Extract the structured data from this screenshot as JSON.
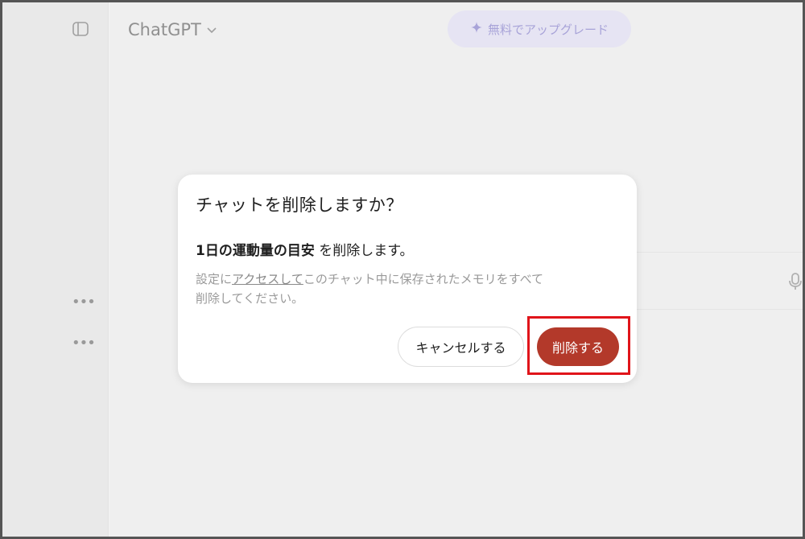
{
  "app": {
    "model_name": "ChatGPT",
    "upgrade_label": "無料でアップグレード"
  },
  "dialog": {
    "title": "チャットを削除しますか？",
    "chat_name": "1日の運動量の目安",
    "delete_suffix": " を削除します。",
    "note_prefix": "設定に",
    "note_link": "アクセスして",
    "note_line1_rest": "このチャット中に保存されたメモリをすべて",
    "note_line2": "削除してください。",
    "cancel_label": "キャンセルする",
    "delete_label": "削除する"
  },
  "sidebar": {
    "more_dots_1": "•••",
    "more_dots_2": "•••"
  },
  "colors": {
    "delete_button": "#b3392a",
    "highlight": "#e0141a",
    "upgrade_bg": "#e6e4f3",
    "upgrade_text": "#a8a3d8"
  },
  "icons": [
    "sidebar-toggle-icon",
    "chevron-down-icon",
    "sparkle-icon",
    "microphone-icon",
    "more-icon"
  ]
}
